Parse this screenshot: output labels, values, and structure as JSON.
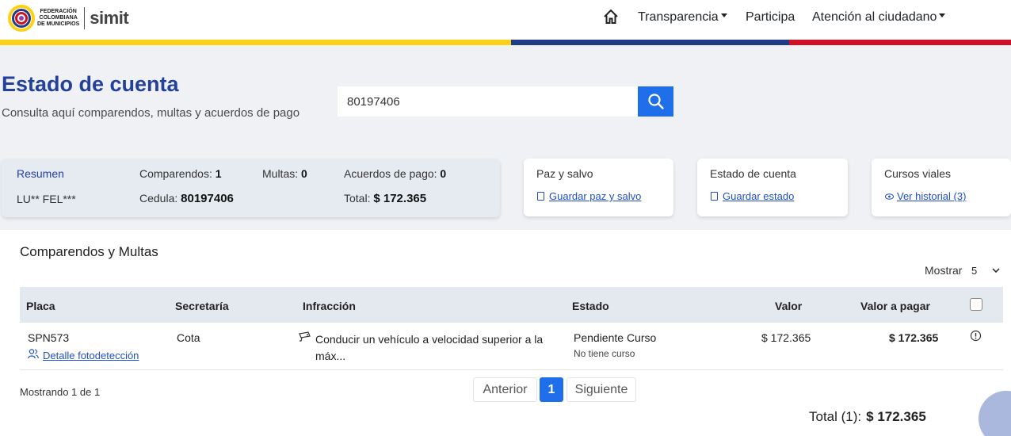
{
  "brand": {
    "logo_text_lines": [
      "FEDERACIÓN",
      "COLOMBIANA",
      "DE MUNICIPIOS"
    ],
    "product": "simit",
    "flag_colors": [
      "#fcd116",
      "#1f3c88",
      "#ce1126"
    ]
  },
  "nav": {
    "home_icon": "home-icon",
    "items": [
      {
        "label": "Transparencia",
        "dropdown": true
      },
      {
        "label": "Participa",
        "dropdown": false
      },
      {
        "label": "Atención al ciudadano",
        "dropdown": true
      }
    ]
  },
  "hero": {
    "title": "Estado de cuenta",
    "subtitle": "Consulta aquí comparendos, multas y acuerdos de pago",
    "search_value": "80197406",
    "search_icon": "search-icon"
  },
  "resumen": {
    "title": "Resumen",
    "name": "LU** FEL***",
    "comparendos_label": "Comparendos:",
    "comparendos_value": "1",
    "multas_label": "Multas:",
    "multas_value": "0",
    "acuerdos_label": "Acuerdos de pago:",
    "acuerdos_value": "0",
    "cedula_label": "Cedula:",
    "cedula_value": "80197406",
    "total_label": "Total:",
    "total_value": "$ 172.365"
  },
  "cards": [
    {
      "title": "Paz y salvo",
      "link": "Guardar paz y salvo",
      "icon": "document-icon"
    },
    {
      "title": "Estado de cuenta",
      "link": "Guardar estado",
      "icon": "document-icon"
    },
    {
      "title": "Cursos viales",
      "link": "Ver historial (3)",
      "icon": "eye-icon"
    }
  ],
  "table": {
    "section_title": "Comparendos y Multas",
    "show_label": "Mostrar",
    "show_value": "5",
    "headers": [
      "Placa",
      "Secretaría",
      "Infracción",
      "Estado",
      "Valor",
      "Valor a pagar"
    ],
    "rows": [
      {
        "placa": "SPN573",
        "detail_link": "Detalle fotodetección",
        "secretaria": "Cota",
        "infraccion": "Conducir un vehículo a velocidad superior a la máx...",
        "estado": "Pendiente Curso",
        "estado_sub": "No tiene curso",
        "valor": "$ 172.365",
        "valor_pagar": "$ 172.365"
      }
    ]
  },
  "pagination": {
    "showing": "Mostrando 1 de 1",
    "prev": "Anterior",
    "page": "1",
    "next": "Siguiente"
  },
  "footer": {
    "total_label": "Total (1):",
    "total_value": "$ 172.365"
  },
  "colors": {
    "accent": "#1f6feb",
    "title_blue": "#23409a",
    "link_blue": "#1f4fc9"
  }
}
